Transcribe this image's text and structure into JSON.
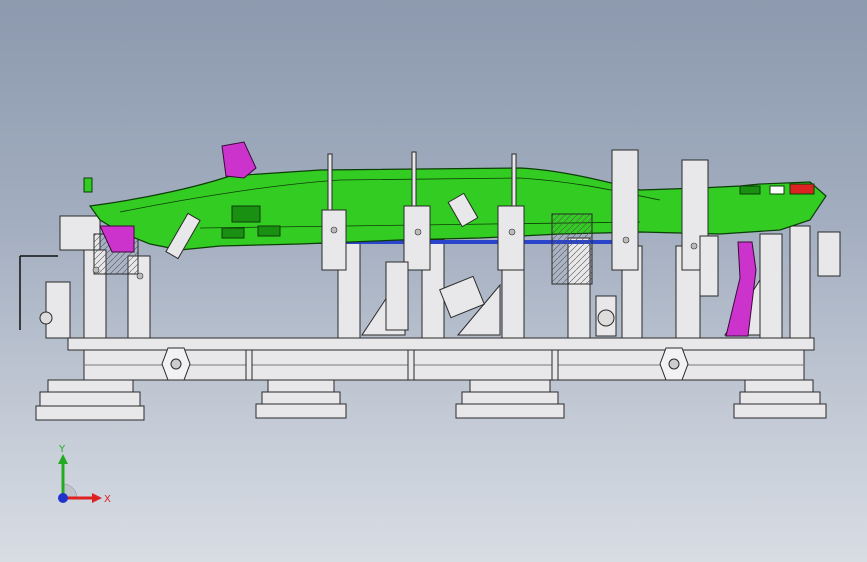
{
  "viewport": {
    "background_top": "#8c99ae",
    "background_bottom": "#d8dde4"
  },
  "model": {
    "part_color": "#33cc22",
    "part_edge_color": "#0d3d08",
    "bracket_color": "#cc33cc",
    "marker_color": "#dd2222",
    "fixture_color": "#e8e8ea",
    "fixture_edge_color": "#2a2a2a",
    "blue_rail_color": "#2a44cc"
  },
  "triad": {
    "x_label": "X",
    "y_label": "Y",
    "x_color": "#dd2222",
    "y_color": "#22aa22",
    "z_color": "#2233cc"
  }
}
